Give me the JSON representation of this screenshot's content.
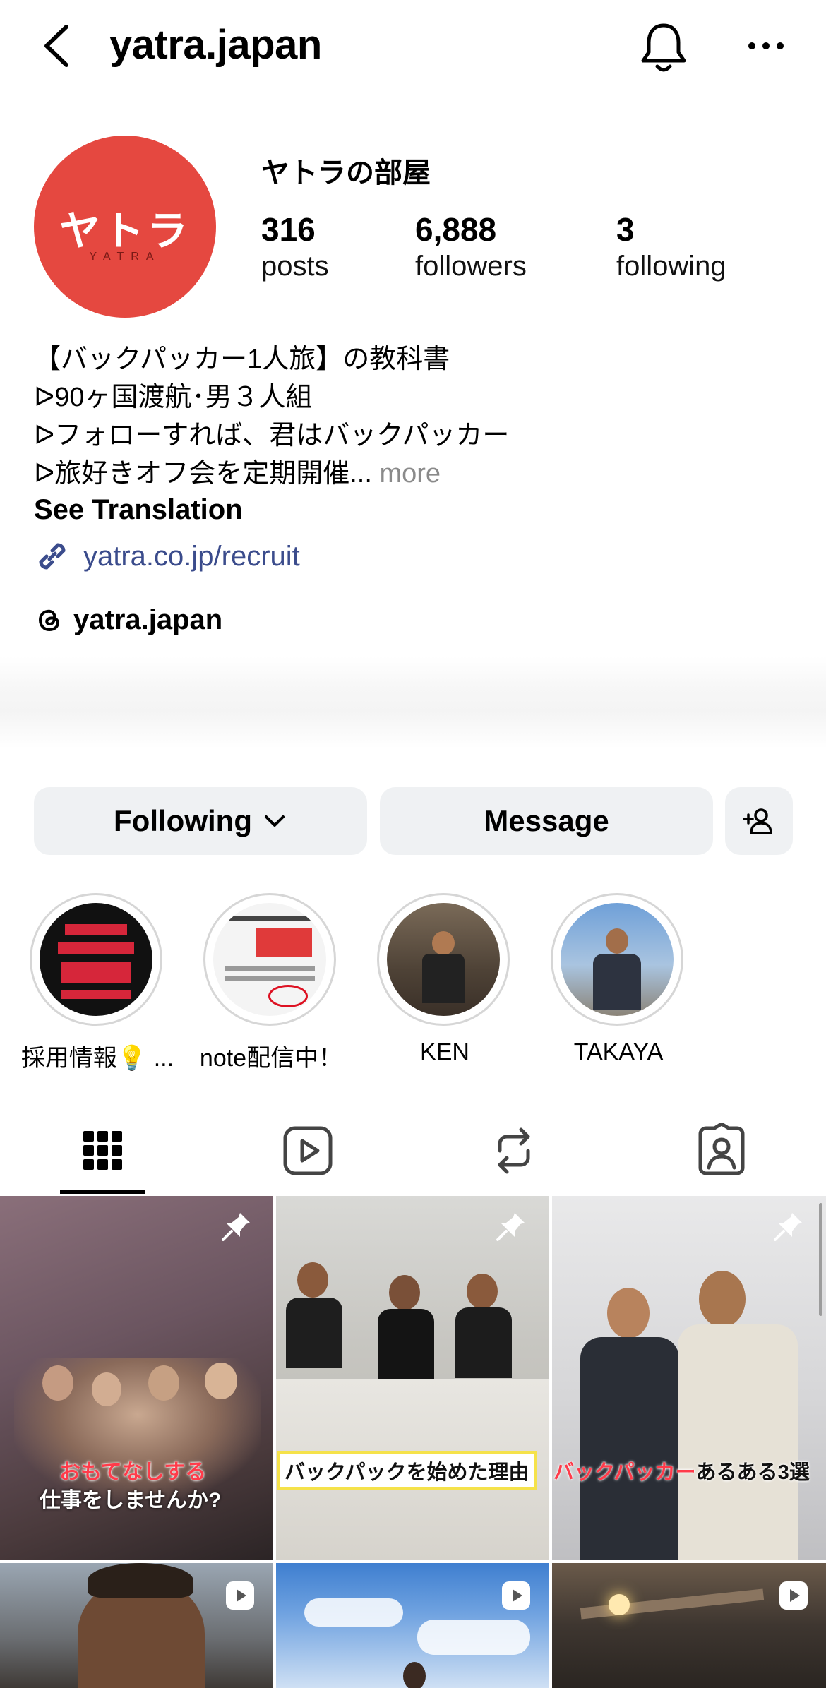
{
  "header": {
    "username": "yatra.japan",
    "back_icon": "chevron-left-icon",
    "bell_icon": "bell-icon",
    "more_icon": "more-horizontal-icon"
  },
  "profile": {
    "avatar_text": "ヤトラ",
    "avatar_subtext": "YATRA",
    "avatar_color": "#e54840",
    "display_name": "ヤトラの部屋",
    "stats": {
      "posts": {
        "value": "316",
        "label": "posts"
      },
      "followers": {
        "value": "6,888",
        "label": "followers"
      },
      "following": {
        "value": "3",
        "label": "following"
      }
    }
  },
  "bio": {
    "lines": [
      "【バックパッカー1人旅】の教科書",
      "ᐅ90ヶ国渡航･男３人組",
      "ᐅフォローすれば、君はバックパッカー",
      "ᐅ旅好きオフ会を定期開催..."
    ],
    "more": " more",
    "see_translation": "See Translation",
    "link": "yatra.co.jp/recruit",
    "threads": "yatra.japan"
  },
  "buttons": {
    "following": "Following",
    "message": "Message",
    "add_person_icon": "add-person-icon"
  },
  "highlights": [
    {
      "label": "採用情報💡 ..."
    },
    {
      "label": "note配信中！"
    },
    {
      "label": "KEN"
    },
    {
      "label": "TAKAYA"
    }
  ],
  "tabs": [
    "grid-icon",
    "reels-icon",
    "reposts-icon",
    "tagged-icon"
  ],
  "posts": [
    {
      "caption_a": "おもてなしする",
      "caption_b": "仕事をしませんか?"
    },
    {
      "caption": "バックパックを始めた理由"
    },
    {
      "caption_a": "バックパッカー",
      "caption_b": "あるある3選"
    }
  ],
  "colors": {
    "link": "#3b4c8c",
    "button_bg": "#eff1f3",
    "accent_red": "#e54840"
  }
}
